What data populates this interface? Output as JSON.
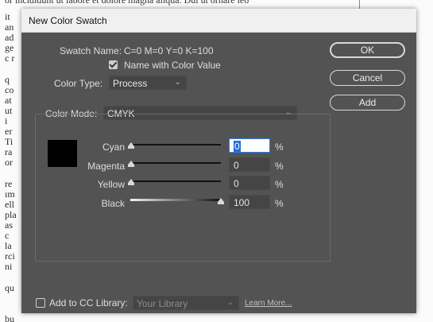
{
  "background_doc": {
    "top_text": "or incididunt ut labore et dolore magna aliqua. Dui ut ornare leo",
    "left_lines": [
      "it",
      "an",
      "ad",
      "ge",
      "c r",
      "",
      "q",
      "co",
      "at",
      "ut",
      "i",
      "er",
      "Ti",
      "ra",
      "or",
      "",
      "re",
      "ım",
      "ell",
      "pla",
      "as",
      "c",
      "la",
      "rci",
      "ni",
      "",
      "qu"
    ],
    "bottom_text": "bu"
  },
  "dialog": {
    "title": "New Color Swatch",
    "swatch_name_label": "Swatch Name:",
    "swatch_name_value": "C=0 M=0 Y=0 K=100",
    "name_with_color_value_label": "Name with Color Value",
    "name_with_color_value_checked": true,
    "color_type_label": "Color Type:",
    "color_type_value": "Process",
    "color_mode_label": "Color Mode:",
    "color_mode_value": "CMYK",
    "buttons": {
      "ok": "OK",
      "cancel": "Cancel",
      "add": "Add"
    },
    "swatch_color": "#000000",
    "sliders": [
      {
        "label": "Cyan",
        "value": "0",
        "percent_sign": "%",
        "level": 0
      },
      {
        "label": "Magenta",
        "value": "0",
        "percent_sign": "%",
        "level": 0
      },
      {
        "label": "Yellow",
        "value": "0",
        "percent_sign": "%",
        "level": 0
      },
      {
        "label": "Black",
        "value": "100",
        "percent_sign": "%",
        "level": 100
      }
    ],
    "cc_library": {
      "label": "Add to CC Library:",
      "checked": false,
      "library_value": "Your Library",
      "learn_more": "Learn More..."
    }
  },
  "colors": {
    "dialog_bg": "#535353",
    "accent": "#1f6fd6"
  }
}
